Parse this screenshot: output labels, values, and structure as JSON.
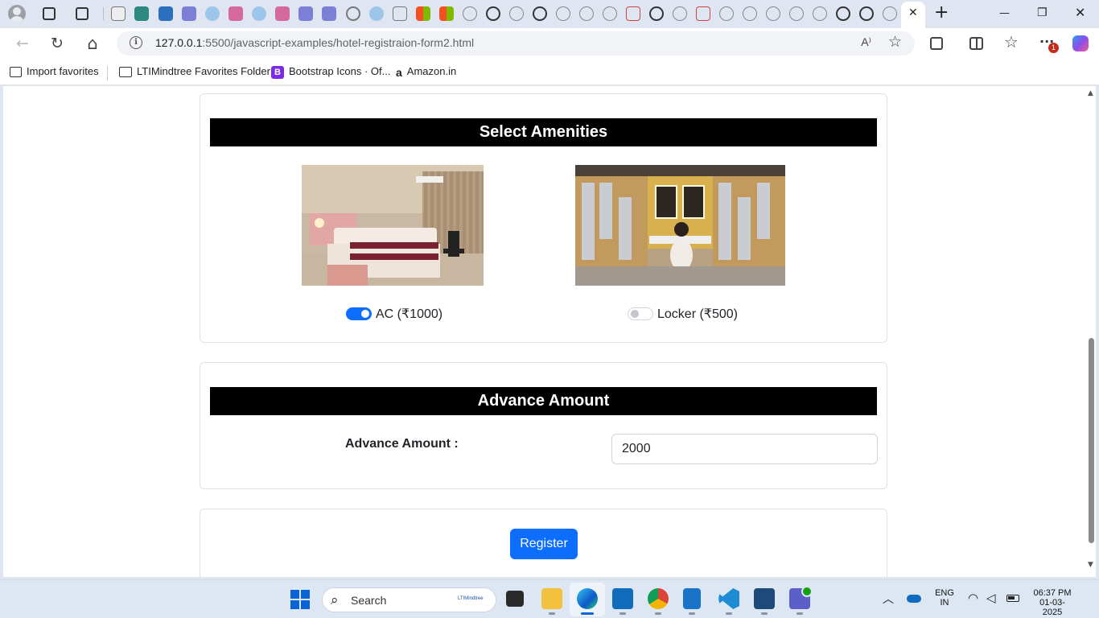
{
  "tabs": {
    "active_close": "✕",
    "new_tab": "+"
  },
  "window_controls": {
    "minimize": "—",
    "restore": "❐",
    "close": "✕"
  },
  "toolbar": {
    "back": "←",
    "reload": "↻",
    "home": "⌂",
    "url_host": "127.0.0.1",
    "url_rest": ":5500/javascript-examples/hotel-registraion-form2.html",
    "read_aloud": "A⁾",
    "favorite": "☆",
    "notification_count": "1"
  },
  "bookmarks": [
    {
      "label": "Import favorites"
    },
    {
      "label": "LTIMindtree Favorites Folder"
    },
    {
      "label": "Bootstrap Icons · Of..."
    },
    {
      "label": "Amazon.in"
    }
  ],
  "page": {
    "amenities": {
      "header": "Select Amenities",
      "items": [
        {
          "label": "AC (₹1000)",
          "checked": true
        },
        {
          "label": "Locker (₹500)",
          "checked": false
        }
      ]
    },
    "advance": {
      "header": "Advance Amount",
      "label": "Advance Amount :",
      "value": "2000"
    },
    "register_label": "Register"
  },
  "taskbar": {
    "search_label": "Search",
    "search_brand": "LTIMindtree",
    "lang_line1": "ENG",
    "lang_line2": "IN",
    "time": "06:37 PM",
    "date": "01-03-2025"
  },
  "colors": {
    "primary": "#0d6efd",
    "header_bg": "#000000",
    "border": "#dee2e6"
  }
}
